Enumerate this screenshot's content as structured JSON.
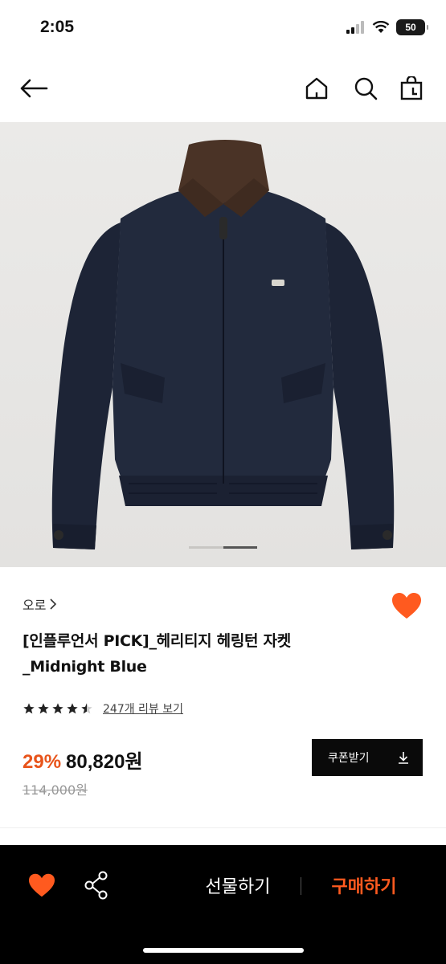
{
  "status_bar": {
    "time": "2:05",
    "battery": "50"
  },
  "nav": {
    "icons": [
      "back-arrow-icon",
      "home-icon",
      "search-icon",
      "shopping-bag-icon"
    ]
  },
  "product": {
    "brand": "오로",
    "title_line1": "[인플루언서 PICK]_헤리티지 헤링턴 자켓",
    "title_line2": "_Midnight Blue",
    "rating": 4.5,
    "review_link": "247개 리뷰 보기",
    "discount": "29%",
    "price": "80,820원",
    "original_price": "114,000원",
    "image_pager": {
      "count": 2,
      "active": 2
    }
  },
  "coupon_button": {
    "label": "쿠폰받기",
    "icon": "download-icon"
  },
  "bottom_bar": {
    "gift_label": "선물하기",
    "buy_label": "구매하기",
    "icons": [
      "heart-icon",
      "share-icon"
    ]
  },
  "colors": {
    "accent": "#e8541b",
    "buy": "#ff5a1f",
    "heart": "#ff5a1f",
    "dark": "#000000",
    "jacket": "#1f2638",
    "collar": "#4a3326"
  }
}
